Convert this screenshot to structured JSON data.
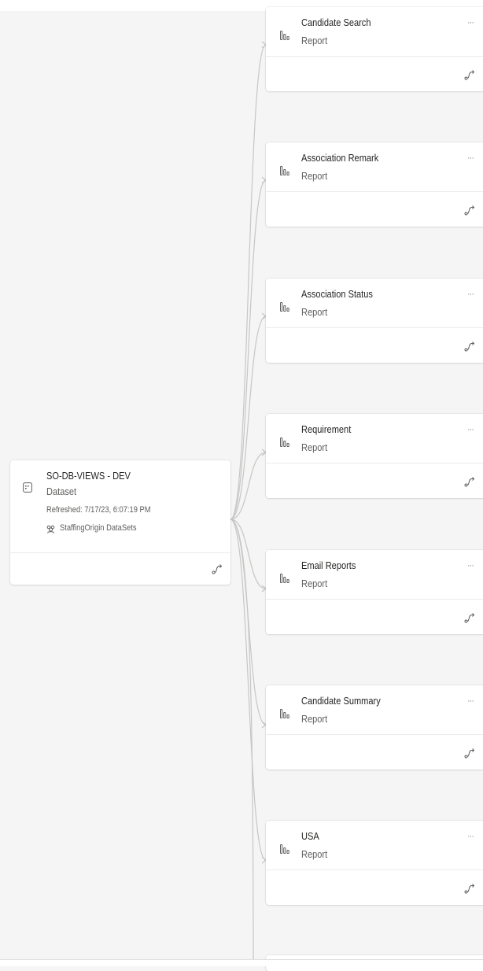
{
  "dataset": {
    "title": "SO-DB-VIEWS - DEV",
    "type": "Dataset",
    "refreshed": "Refreshed: 7/17/23, 6:07:19 PM",
    "workspace": "StaffingOrigin DataSets"
  },
  "reports": [
    {
      "title": "Candidate Search",
      "type": "Report"
    },
    {
      "title": "Association Remark",
      "type": "Report"
    },
    {
      "title": "Association Status",
      "type": "Report"
    },
    {
      "title": "Requirement",
      "type": "Report"
    },
    {
      "title": "Email Reports",
      "type": "Report"
    },
    {
      "title": "Candidate Summary",
      "type": "Report"
    },
    {
      "title": "USA",
      "type": "Report"
    }
  ],
  "more_symbol": "···",
  "icons": {
    "dataset": "dataset-icon",
    "report": "report-icon",
    "workspace": "workspace-icon",
    "lineage": "lineage-icon"
  },
  "colors": {
    "canvas": "#f5f5f5",
    "card": "#ffffff",
    "connector": "#c8c6c4",
    "text": "#252423",
    "subtext": "#605e5c"
  }
}
